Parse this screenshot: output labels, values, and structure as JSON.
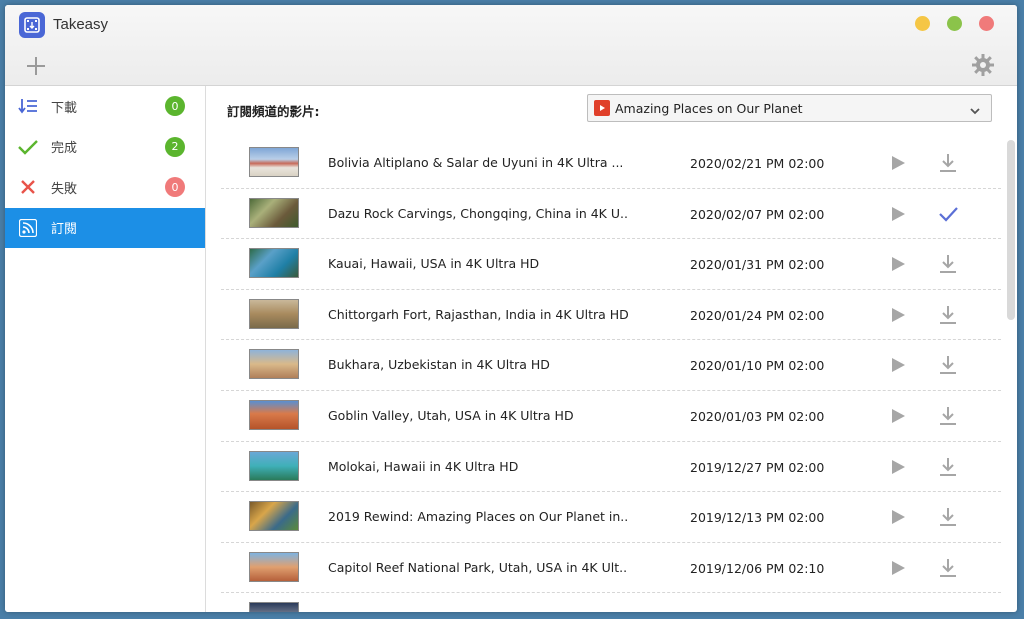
{
  "app": {
    "title": "Takeasy"
  },
  "colors": {
    "accent": "#1c8fe6",
    "badge_green": "#5bb52e",
    "badge_red": "#f07a7a",
    "check_blue": "#5b6fd6"
  },
  "sidebar": {
    "items": [
      {
        "label": "下載",
        "count": "0",
        "icon": "download-list-icon"
      },
      {
        "label": "完成",
        "count": "2",
        "icon": "check-icon"
      },
      {
        "label": "失敗",
        "count": "0",
        "icon": "close-icon"
      },
      {
        "label": "訂閱",
        "icon": "rss-icon"
      }
    ]
  },
  "main": {
    "subscription_label": "訂閱頻道的影片:",
    "channel": "Amazing Places on Our Planet"
  },
  "videos": [
    {
      "title": "Bolivia Altiplano & Salar de Uyuni in 4K Ultra ...",
      "date": "2020/02/21 PM 02:00",
      "status": "download"
    },
    {
      "title": "Dazu Rock Carvings, Chongqing, China in 4K U...",
      "date": "2020/02/07 PM 02:00",
      "status": "done"
    },
    {
      "title": "Kauai, Hawaii, USA in 4K Ultra HD",
      "date": "2020/01/31 PM 02:00",
      "status": "download"
    },
    {
      "title": "Chittorgarh Fort, Rajasthan, India in 4K Ultra HD",
      "date": "2020/01/24 PM 02:00",
      "status": "download"
    },
    {
      "title": "Bukhara, Uzbekistan in 4K Ultra HD",
      "date": "2020/01/10 PM 02:00",
      "status": "download"
    },
    {
      "title": "Goblin Valley, Utah, USA in 4K Ultra HD",
      "date": "2020/01/03 PM 02:00",
      "status": "download"
    },
    {
      "title": "Molokai, Hawaii in 4K Ultra HD",
      "date": "2019/12/27 PM 02:00",
      "status": "download"
    },
    {
      "title": "2019 Rewind: Amazing Places on Our Planet in...",
      "date": "2019/12/13 PM 02:00",
      "status": "download"
    },
    {
      "title": "Capitol Reef National Park, Utah, USA in 4K Ult...",
      "date": "2019/12/06 PM 02:10",
      "status": "download"
    }
  ]
}
